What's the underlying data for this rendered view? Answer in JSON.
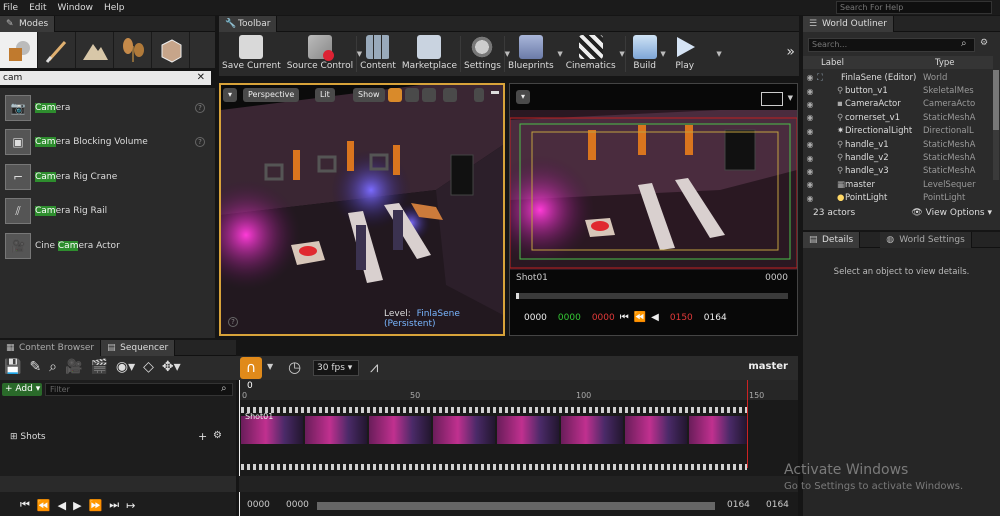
{
  "menu": [
    "File",
    "Edit",
    "Window",
    "Help"
  ],
  "help_search_placeholder": "Search For Help",
  "modes": {
    "tab_label": "Modes",
    "search_value": "cam",
    "items": [
      {
        "pre": "",
        "hl": "Cam",
        "post": "era"
      },
      {
        "pre": "",
        "hl": "Cam",
        "post": "era Blocking Volume"
      },
      {
        "pre": "",
        "hl": "Cam",
        "post": "era Rig Crane"
      },
      {
        "pre": "",
        "hl": "Cam",
        "post": "era Rig Rail"
      },
      {
        "pre": "Cine ",
        "hl": "Cam",
        "post": "era Actor"
      }
    ]
  },
  "toolbar": {
    "tab_label": "Toolbar",
    "buttons": [
      "Save Current",
      "Source Control",
      "Content",
      "Marketplace",
      "Settings",
      "Blueprints",
      "Cinematics",
      "Build",
      "Play"
    ],
    "overflow": "»"
  },
  "viewport_left": {
    "perspective": "Perspective",
    "lit": "Lit",
    "show": "Show",
    "level_label": "Level:",
    "level_name": "FinlaSene (Persistent)"
  },
  "viewport_right": {
    "shot_name": "Shot01",
    "shot_frame": "0000",
    "t1": "0000",
    "t2": "0000",
    "t3": "0000",
    "t4": "0150",
    "t5": "0164"
  },
  "outliner": {
    "tab_label": "World Outliner",
    "search_placeholder": "Search...",
    "col_label": "Label",
    "col_type": "Type",
    "rows": [
      {
        "label": "FinlaSene (Editor)",
        "type": "World"
      },
      {
        "label": "button_v1",
        "type": "SkeletalMes"
      },
      {
        "label": "CameraActor",
        "type": "CameraActo"
      },
      {
        "label": "cornerset_v1",
        "type": "StaticMeshA"
      },
      {
        "label": "DirectionalLight",
        "type": "DirectionalL"
      },
      {
        "label": "handle_v1",
        "type": "StaticMeshA"
      },
      {
        "label": "handle_v2",
        "type": "StaticMeshA"
      },
      {
        "label": "handle_v3",
        "type": "StaticMeshA"
      },
      {
        "label": "master",
        "type": "LevelSequer"
      },
      {
        "label": "PointLight",
        "type": "PointLight"
      }
    ],
    "actor_count": "23 actors",
    "view_options": "View Options"
  },
  "details": {
    "tab_details": "Details",
    "tab_world": "World Settings",
    "empty_msg": "Select an object to view details."
  },
  "sequencer": {
    "tab_content": "Content Browser",
    "tab_seq": "Sequencer",
    "fps": "30 fps",
    "seq_name": "master",
    "add_label": "Add",
    "filter_placeholder": "Filter",
    "shots_label": "Shots",
    "ruler": [
      "0",
      "50",
      "100",
      "150"
    ],
    "ruler_zero": "0",
    "track_label": "Shot01",
    "bottom_times": [
      "0000",
      "0000",
      "0164",
      "0164"
    ]
  },
  "watermark": {
    "line1": "Activate Windows",
    "line2": "Go to Settings to activate Windows."
  },
  "colors": {
    "accent_orange": "#d8a33a",
    "highlight_green": "#2e8d2e",
    "timecode_green": "#34c934",
    "timecode_red": "#e23a3a"
  }
}
